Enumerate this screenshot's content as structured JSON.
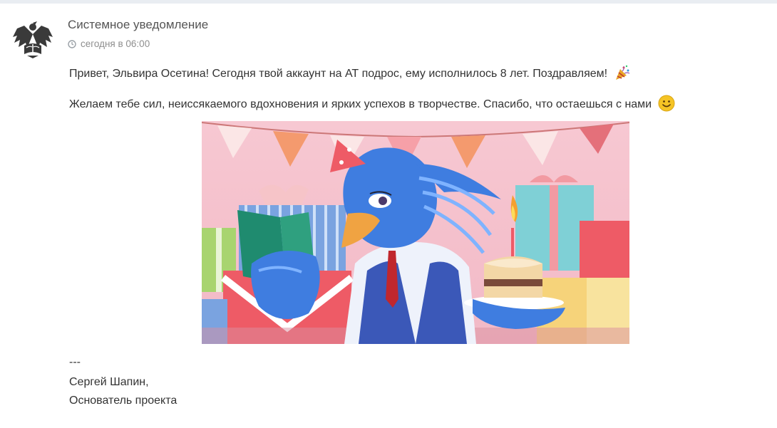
{
  "notification": {
    "sender": "Системное уведомление",
    "time": "сегодня в 06:00",
    "avatar_icon": "phoenix-book-logo",
    "message_line1": "Привет, Эльвира Осетина! Сегодня твой аккаунт на АТ подрос, ему исполнилось 8 лет. Поздравляем!",
    "message_line2": "Желаем тебе сил, неиссякаемого вдохновения и ярких успехов в творчестве. Спасибо, что остаешься с нами",
    "emoji_1": "party-popper-icon",
    "emoji_2": "smile-icon",
    "image": "birthday-bird-illustration",
    "signature_separator": "---",
    "signature_name": "Сергей Шапин,",
    "signature_role": "Основатель проекта"
  },
  "colors": {
    "topbar": "#e9edf2",
    "text": "#333333",
    "meta": "#8e8e8e",
    "picture_bg": "#f6c6cf"
  }
}
